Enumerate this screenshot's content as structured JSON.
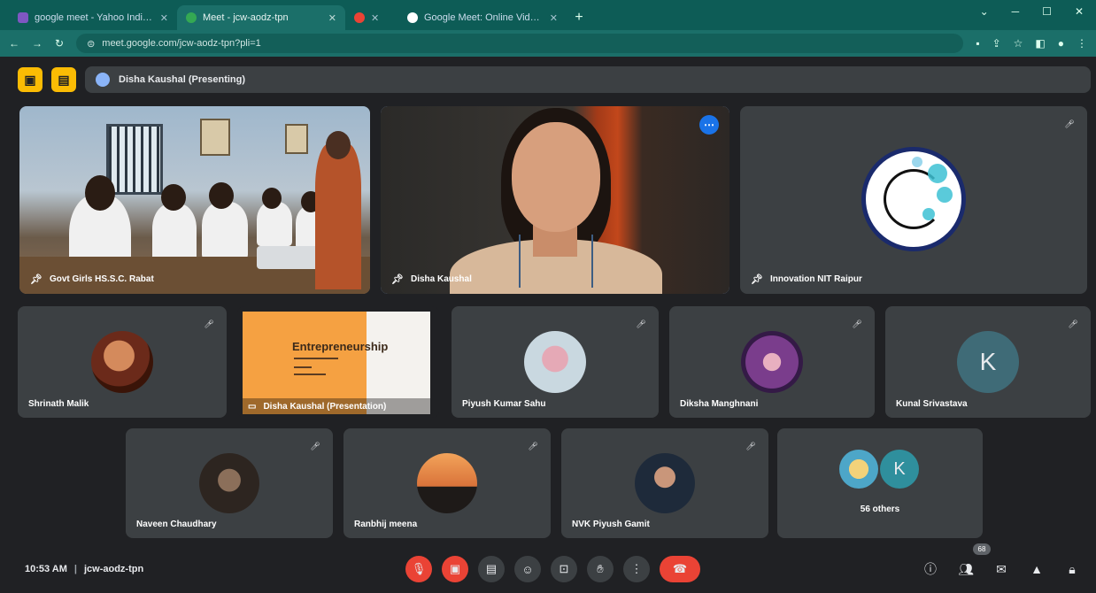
{
  "browser": {
    "tabs": [
      {
        "label": "google meet - Yahoo India Sea",
        "favicon_color": "#7e57c2"
      },
      {
        "label": "Meet - jcw-aodz-tpn",
        "favicon_color": "#34a853"
      },
      {
        "label": "",
        "favicon_color": "#ea4335"
      },
      {
        "label": "Google Meet: Online Video Con",
        "favicon_color": "#ffffff"
      }
    ],
    "new_tab": "+",
    "url": "meet.google.com/jcw-aodz-tpn?pli=1"
  },
  "meeting": {
    "presenting_label": "Disha Kaushal (Presenting)",
    "tiles": {
      "classroom": "Govt Girls HS.S.C. Rabat",
      "presenter": "Disha Kaushal",
      "innovation": "Innovation NIT Raipur",
      "shrinath": "Shrinath Malik",
      "slide_owner": "Disha Kaushal (Presentation)",
      "slide_title": "Entrepreneurship",
      "piyush": "Piyush Kumar Sahu",
      "diksha": "Diksha Manghnani",
      "kunal": "Kunal Srivastava",
      "kunal_initial": "K",
      "naveen": "Naveen Chaudhary",
      "ranbhij": "Ranbhij meena",
      "nvk": "NVK Piyush Gamit",
      "others": "56 others",
      "others_initial": "K"
    }
  },
  "bottom": {
    "time": "10:53 AM",
    "meeting_code": "jcw-aodz-tpn",
    "participants_count": "68"
  }
}
